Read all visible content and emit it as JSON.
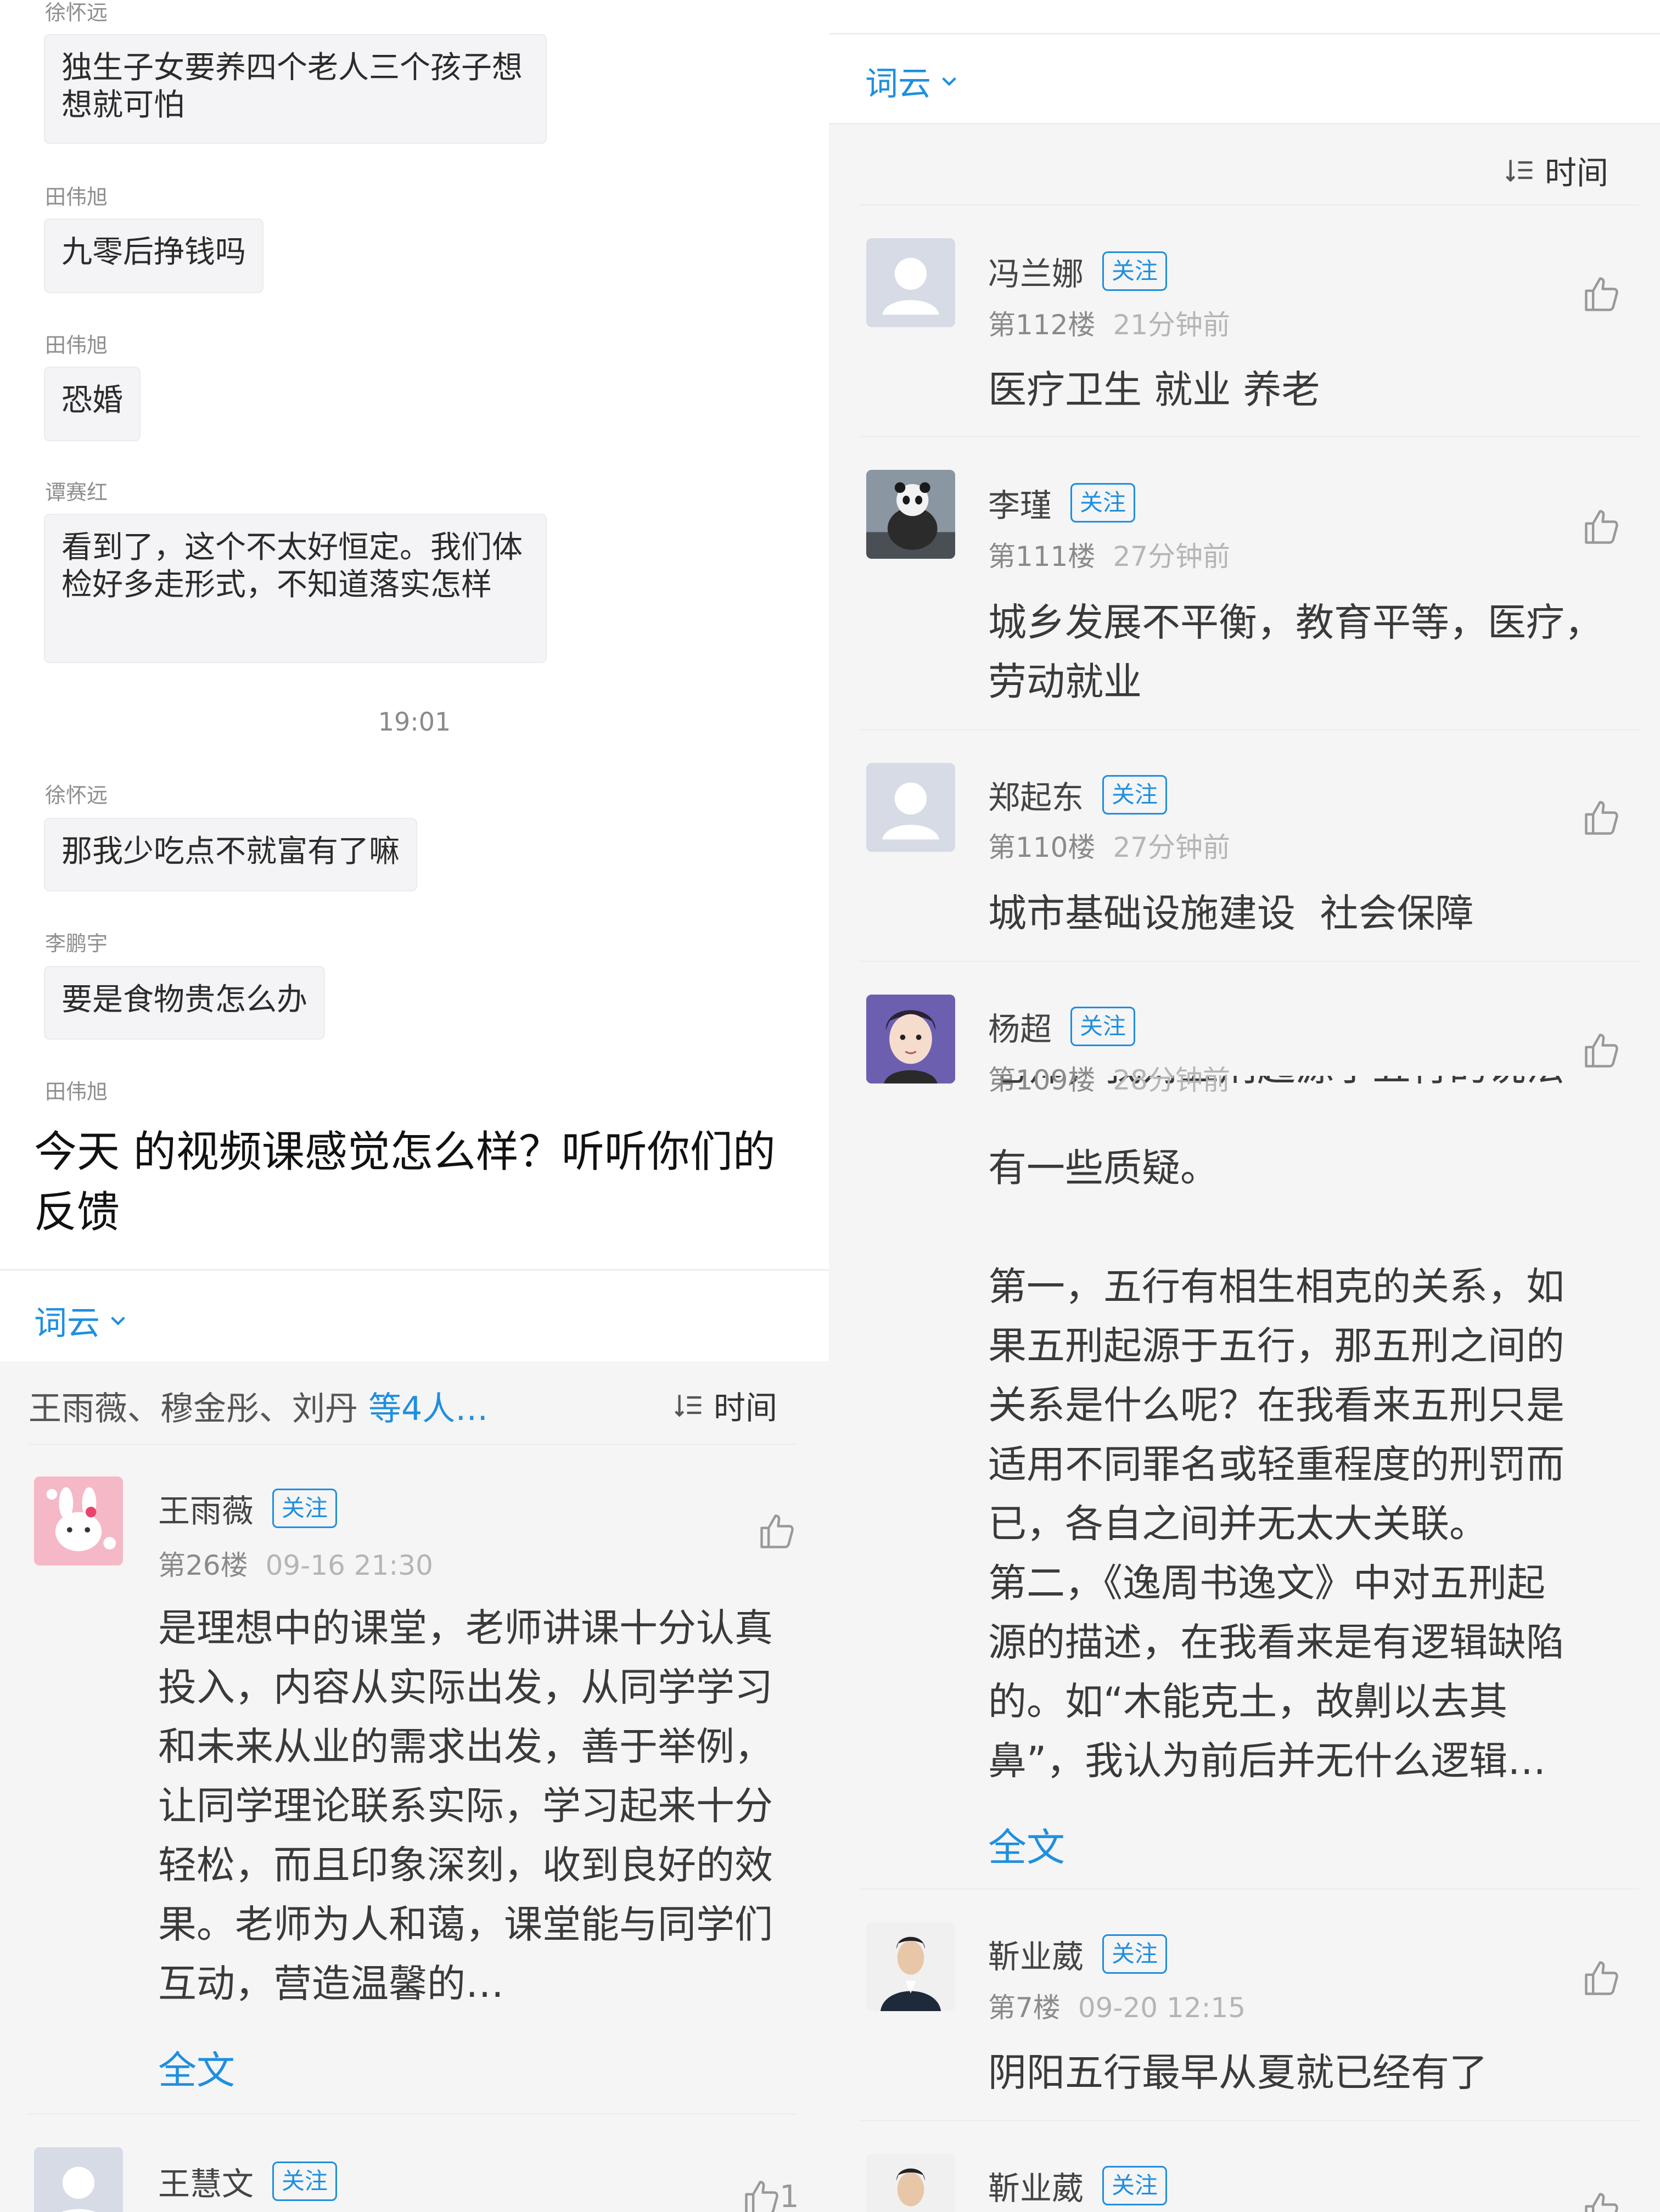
{
  "chat": {
    "messages": [
      {
        "sender": "徐怀远",
        "text": "独生子女要养四个老人三个孩子想想就可怕"
      },
      {
        "sender": "田伟旭",
        "text": "九零后挣钱吗"
      },
      {
        "sender": "田伟旭",
        "text": "恐婚"
      },
      {
        "sender": "谭赛红",
        "text": "看到了，这个不太好恒定。我们体检好多走形式，不知道落实怎样"
      },
      {
        "sender": "徐怀远",
        "text": "那我少吃点不就富有了嘛"
      },
      {
        "sender": "李鹏宇",
        "text": "要是食物贵怎么办"
      },
      {
        "sender": "田伟旭",
        "text": "今天 的视频课感觉怎么样？听听你们的反馈"
      }
    ],
    "time_divider": "19:01"
  },
  "left_panel": {
    "cloud_label": "词云",
    "likes_names": "王雨薇、穆金彤、刘丹",
    "likes_more": "等4人…",
    "sort_label": "时间",
    "comments": [
      {
        "name": "王雨薇",
        "follow": "关注",
        "floor": "第26楼",
        "time": "09-16 21:30",
        "text": "是理想中的课堂，老师讲课十分认真投入，内容从实际出发，从同学学习和未来从业的需求出发，善于举例，让同学理论联系实际，学习起来十分轻松，而且印象深刻，收到良好的效果。老师为人和蔼，课堂能与同学们互动，营造温馨的…",
        "full": "全文"
      },
      {
        "name": "王慧文",
        "follow": "关注",
        "likes": "1"
      }
    ]
  },
  "right_panel": {
    "cloud_label": "词云",
    "sort_label": "时间",
    "comments": [
      {
        "name": "冯兰娜",
        "follow": "关注",
        "floor": "第112楼",
        "time": "21分钟前",
        "text": "医疗卫生 就业 养老"
      },
      {
        "name": "李瑾",
        "follow": "关注",
        "floor": "第111楼",
        "time": "27分钟前",
        "text": "城乡发展不平衡，教育平等，医疗，劳动就业"
      },
      {
        "name": "郑起东",
        "follow": "关注",
        "floor": "第110楼",
        "time": "27分钟前",
        "text": "城市基础设施建设  社会保障"
      },
      {
        "name": "杨超",
        "follow": "关注",
        "floor": "第109楼",
        "time": "28分钟前",
        "text_cut": "老师，我对五刑起源于五行的说法",
        "text_lines": [
          "有一些质疑。",
          "",
          "第一，五行有相生相克的关系，如",
          "果五刑起源于五行，那五刑之间的",
          "关系是什么呢？在我看来五刑只是",
          "适用不同罪名或轻重程度的刑罚而",
          "已，各自之间并无太大关联。",
          "第二，《逸周书逸文》中对五刑起",
          "源的描述，在我看来是有逻辑缺陷",
          "的。如“木能克土，故劓以去其",
          "鼻”，我认为前后并无什么逻辑…"
        ],
        "full": "全文"
      },
      {
        "name": "靳业葳",
        "follow": "关注",
        "floor": "第7楼",
        "time": "09-20 12:15",
        "text": "阴阳五行最早从夏就已经有了"
      },
      {
        "name": "靳业葳",
        "follow": "关注"
      }
    ]
  },
  "colors": {
    "accent": "#1f8fdf",
    "bubble_bg": "#f4f4f6",
    "panel_bg": "#f5f5f5"
  }
}
